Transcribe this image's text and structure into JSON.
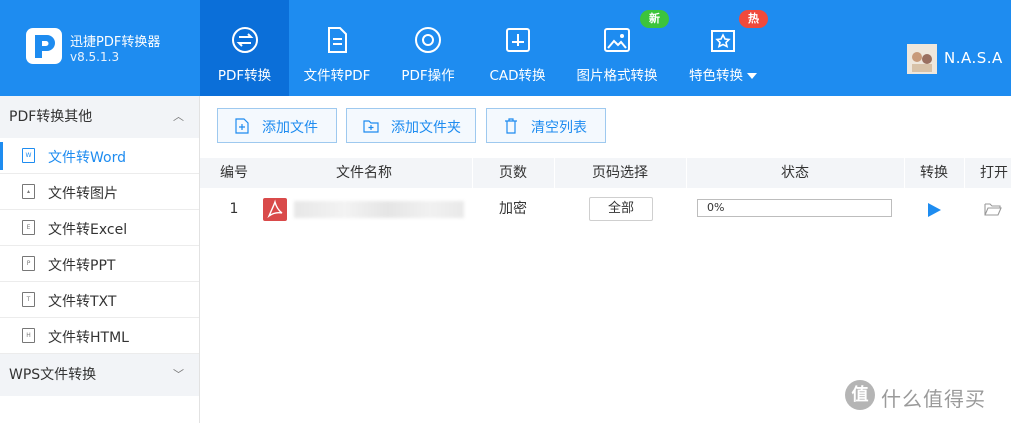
{
  "app": {
    "name": "迅捷PDF转换器",
    "version": "v8.5.1.3"
  },
  "nav": {
    "tabs": [
      {
        "label": "PDF转换",
        "icon": "convert-arrows-icon"
      },
      {
        "label": "文件转PDF",
        "icon": "document-icon"
      },
      {
        "label": "PDF操作",
        "icon": "gear-circle-icon"
      },
      {
        "label": "CAD转换",
        "icon": "cad-icon"
      },
      {
        "label": "图片格式转换",
        "icon": "image-icon"
      },
      {
        "label": "特色转换",
        "icon": "star-box-icon"
      }
    ],
    "badges": {
      "new": "新",
      "hot": "热"
    }
  },
  "user": {
    "name": "N.A.S.A"
  },
  "sidebar": {
    "group1": {
      "title": "PDF转换其他"
    },
    "items": [
      {
        "label": "文件转Word",
        "icon_letter": "W"
      },
      {
        "label": "文件转图片",
        "icon_letter": ""
      },
      {
        "label": "文件转Excel",
        "icon_letter": "E"
      },
      {
        "label": "文件转PPT",
        "icon_letter": "P"
      },
      {
        "label": "文件转TXT",
        "icon_letter": "T"
      },
      {
        "label": "文件转HTML",
        "icon_letter": "H"
      }
    ],
    "group2": {
      "title": "WPS文件转换"
    }
  },
  "toolbar": {
    "add_file": "添加文件",
    "add_folder": "添加文件夹",
    "clear_list": "清空列表"
  },
  "table": {
    "columns": [
      "编号",
      "文件名称",
      "页数",
      "页码选择",
      "状态",
      "转换",
      "打开"
    ],
    "rows": [
      {
        "index": "1",
        "pages": "加密",
        "page_select": "全部",
        "progress_text": "0%",
        "progress": 0
      }
    ]
  },
  "watermark": {
    "badge": "值",
    "text": "什么值得买"
  },
  "colors": {
    "primary": "#1e8cf0",
    "active_tab": "#0b6fd9",
    "badge_new": "#3cc43c",
    "badge_hot": "#f04a3c",
    "pdf_red": "#d94a4a"
  }
}
